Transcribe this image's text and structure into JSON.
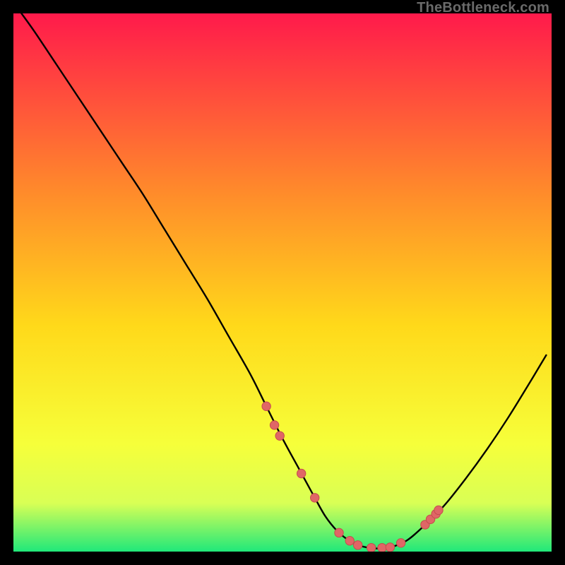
{
  "watermark": "TheBottleneck.com",
  "colors": {
    "gradient_top": "#ff1a4b",
    "gradient_mid1": "#ff8a2b",
    "gradient_mid2": "#ffd91a",
    "gradient_mid3": "#f6ff3a",
    "gradient_bottom": "#20e87a",
    "curve": "#000000",
    "dot_fill": "#e06666",
    "dot_stroke": "#c44d4d",
    "frame_bg": "#000000"
  },
  "chart_data": {
    "type": "line",
    "title": "",
    "xlabel": "",
    "ylabel": "",
    "xlim": [
      0,
      100
    ],
    "ylim": [
      0,
      100
    ],
    "series": [
      {
        "name": "bottleneck-curve",
        "x": [
          1.5,
          4,
          8,
          12,
          16,
          20,
          24,
          28,
          32,
          36,
          40,
          44,
          47,
          50,
          53,
          56,
          58,
          60,
          62,
          64,
          67,
          70,
          73,
          76,
          80,
          84,
          88,
          92,
          96,
          99
        ],
        "y": [
          100,
          96.5,
          90.5,
          84.5,
          78.5,
          72.5,
          66.5,
          60,
          53.5,
          47,
          40,
          33,
          27,
          21,
          15.5,
          10,
          6.5,
          4,
          2.3,
          1.2,
          0.6,
          0.8,
          2.0,
          4.5,
          8.5,
          13.5,
          19,
          25,
          31.5,
          36.5
        ]
      }
    ],
    "scatter": [
      {
        "name": "sample-points",
        "x": [
          47,
          48.5,
          49.5,
          53.5,
          56,
          60.5,
          62.5,
          64,
          66.5,
          68.5,
          70,
          72,
          76.5,
          77.5,
          78.5,
          79
        ],
        "y": [
          27,
          23.5,
          21.5,
          14.5,
          10,
          3.5,
          2.0,
          1.2,
          0.7,
          0.7,
          0.8,
          1.6,
          5.0,
          6.0,
          7.0,
          7.7
        ]
      }
    ]
  }
}
